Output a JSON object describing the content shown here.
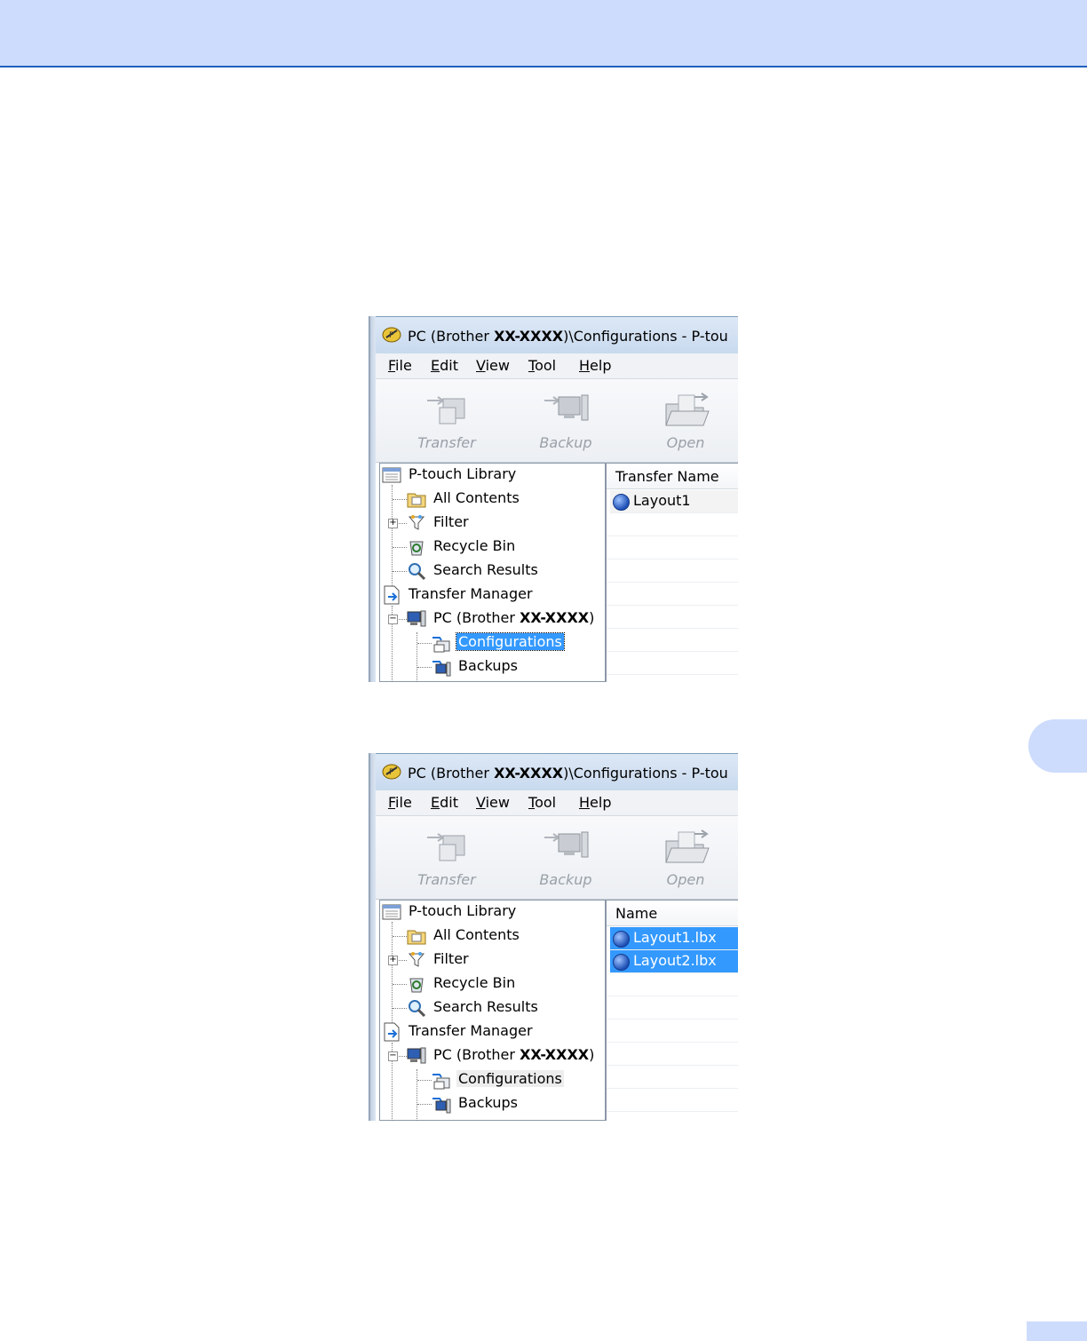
{
  "window": {
    "title_prefix": "PC (Brother ",
    "title_model": "XX-XXXX",
    "title_suffix": ")\\Configurations - P-tou"
  },
  "menu": [
    "File",
    "Edit",
    "View",
    "Tool",
    "Help"
  ],
  "toolbar": {
    "transfer": "Transfer",
    "backup": "Backup",
    "open": "Open"
  },
  "tree": {
    "library": "P-touch Library",
    "all_contents": "All Contents",
    "filter": "Filter",
    "recycle_bin": "Recycle Bin",
    "search_results": "Search Results",
    "transfer_manager": "Transfer Manager",
    "pc_prefix": "PC (Brother ",
    "pc_model": "XX-XXXX",
    "pc_suffix": ")",
    "configurations": "Configurations",
    "backups": "Backups"
  },
  "screenshot1": {
    "column": "Transfer Name",
    "rows": [
      "Layout1"
    ]
  },
  "screenshot2": {
    "column": "Name",
    "rows": [
      "Layout1.lbx",
      "Layout2.lbx"
    ]
  },
  "colors": {
    "header_band": "#cddcfc",
    "selection": "#3399ff"
  }
}
